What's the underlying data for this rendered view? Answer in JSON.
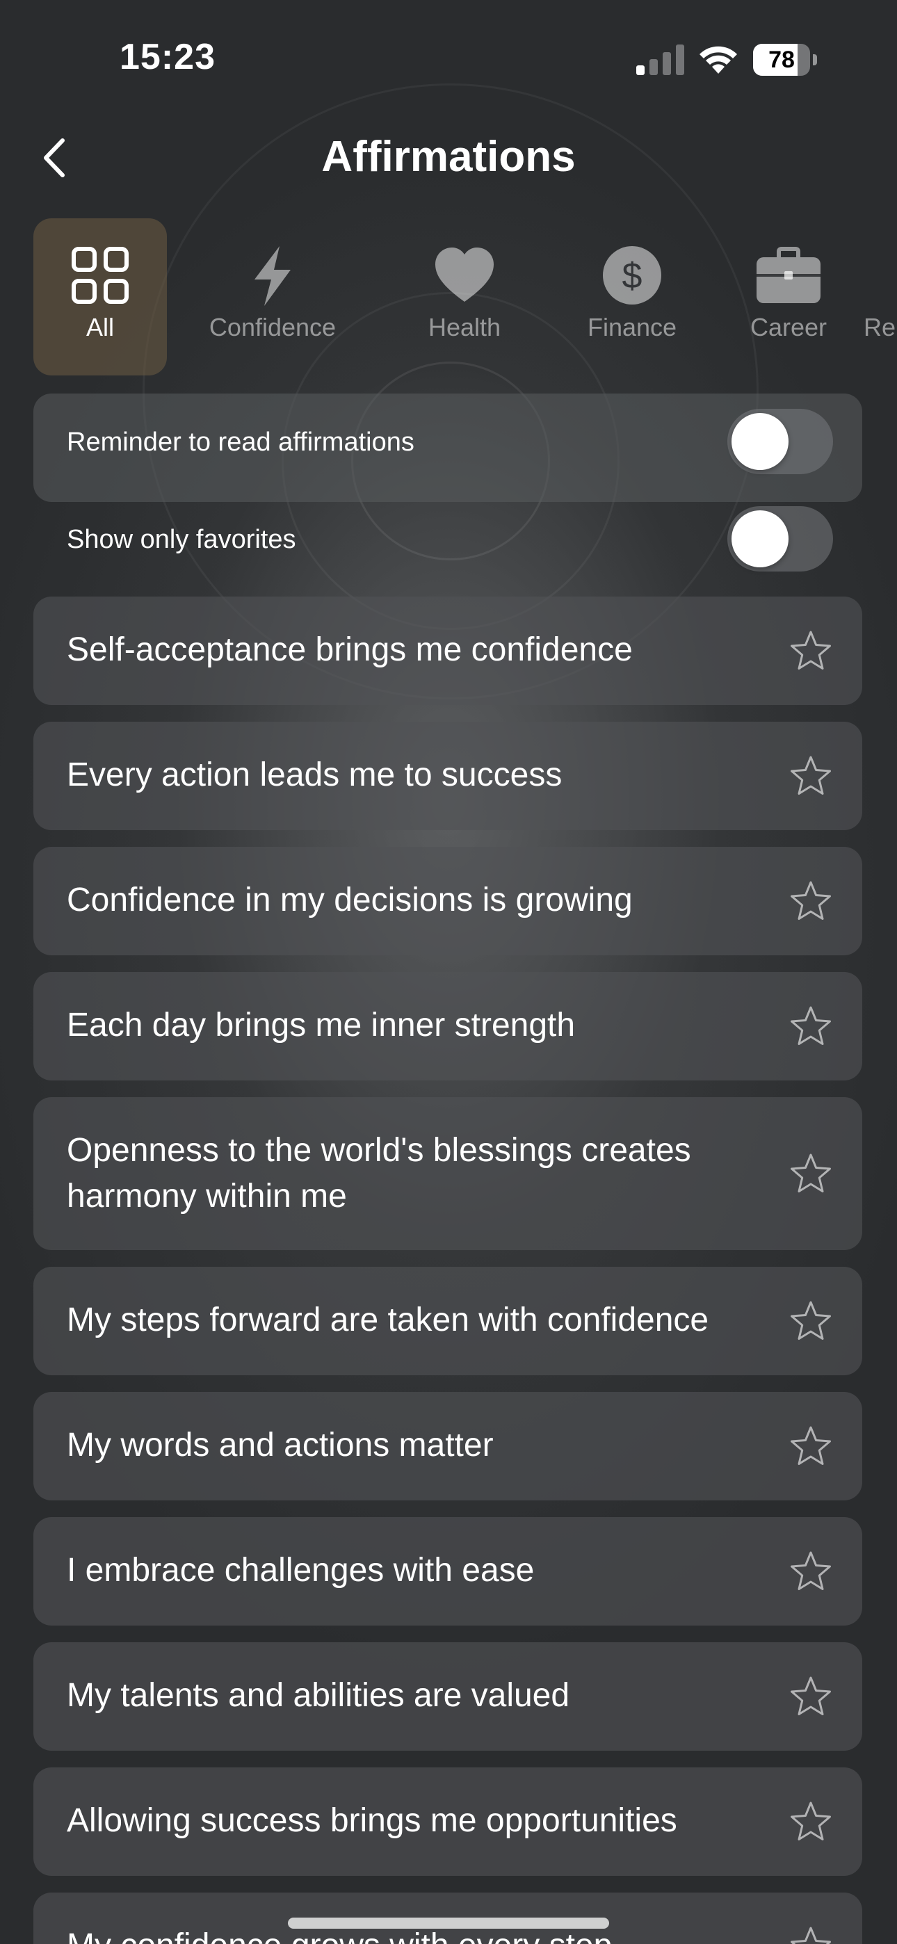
{
  "status_bar": {
    "time": "15:23",
    "battery_level": "78",
    "battery_fraction": 0.78
  },
  "nav": {
    "title": "Affirmations",
    "back_icon": "chevron-left-icon"
  },
  "categories": [
    {
      "label": "All",
      "icon": "grid-icon",
      "active": true
    },
    {
      "label": "Confidence",
      "icon": "lightning-icon",
      "active": false
    },
    {
      "label": "Health",
      "icon": "heart-icon",
      "active": false
    },
    {
      "label": "Finance",
      "icon": "dollar-icon",
      "active": false
    },
    {
      "label": "Career",
      "icon": "briefcase-icon",
      "active": false
    },
    {
      "label": "Rel",
      "icon": "",
      "active": false
    }
  ],
  "settings": {
    "reminder_label": "Reminder to read affirmations",
    "reminder_on": false,
    "favorites_label": "Show only favorites",
    "favorites_on": false
  },
  "affirmations": [
    {
      "text": "Self-acceptance brings me confidence",
      "favorite": false
    },
    {
      "text": "Every action leads me to success",
      "favorite": false
    },
    {
      "text": "Confidence in my decisions is growing",
      "favorite": false
    },
    {
      "text": "Each day brings me inner strength",
      "favorite": false
    },
    {
      "text": "Openness to the world's blessings creates harmony within me",
      "favorite": false
    },
    {
      "text": "My steps forward are taken with confidence",
      "favorite": false
    },
    {
      "text": "My words and actions matter",
      "favorite": false
    },
    {
      "text": "I embrace challenges with ease",
      "favorite": false
    },
    {
      "text": "My talents and abilities are valued",
      "favorite": false
    },
    {
      "text": "Allowing success brings me opportunities",
      "favorite": false
    },
    {
      "text": "My confidence grows with every step",
      "favorite": false
    }
  ],
  "colors": {
    "active_category_bg": "#6e5c44",
    "card_bg": "#505255"
  }
}
